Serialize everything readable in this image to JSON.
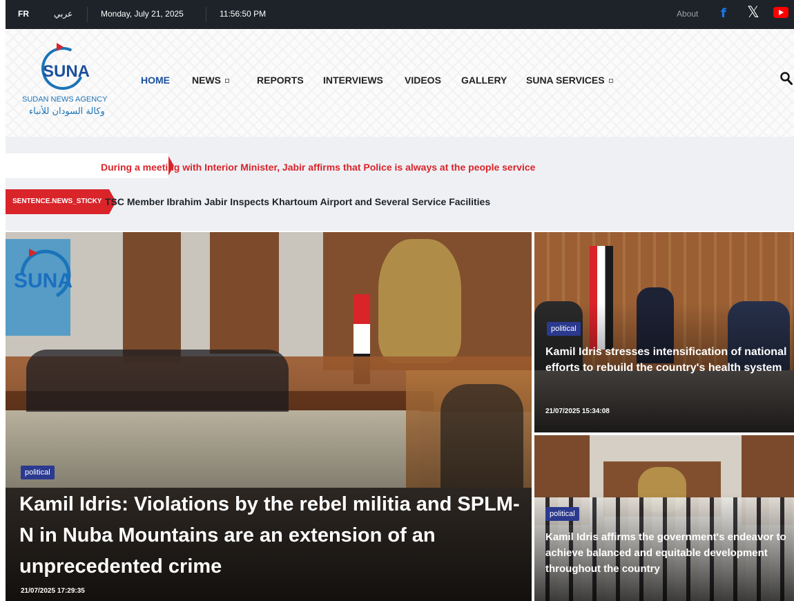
{
  "topbar": {
    "lang_fr": "FR",
    "lang_ar": "عربي",
    "date": "Monday, July 21, 2025",
    "time": "11:56:50 PM",
    "about": "About",
    "social": [
      "facebook-icon",
      "x-icon",
      "youtube-icon"
    ],
    "colors": {
      "background": "#1e2329",
      "facebook": "#1877f2",
      "youtube": "#ff0000"
    }
  },
  "logo": {
    "word": "SUNA",
    "english": "SUDAN NEWS AGENCY",
    "arabic": "وكالة السودان للأنباء",
    "colors": {
      "blue": "#1b4f9c",
      "red": "#d9242a"
    }
  },
  "nav": {
    "items": [
      {
        "label": "HOME",
        "active": true
      },
      {
        "label": "NEWS",
        "has_dropdown": true
      },
      {
        "label": "REPORTS"
      },
      {
        "label": "INTERVIEWS"
      },
      {
        "label": "VIDEOS"
      },
      {
        "label": "GALLERY"
      },
      {
        "label": "SUNA SERVICES",
        "has_dropdown": true
      }
    ],
    "search_icon": "search-icon"
  },
  "ticker": {
    "headline_1": "During a meeting with Interior Minister, Jabir affirms that Police is always at the people service",
    "label": "SENTENCE.NEWS_STICKY",
    "headline_2": "TSC Member Ibrahim Jabir Inspects Khartoum Airport and Several Service Facilities",
    "accent": "#d9242a"
  },
  "featured": {
    "main": {
      "category": "political",
      "title": "Kamil Idris: Violations by the rebel militia and SPLM-N in Nuba Mountains are an extension of an unprecedented crime",
      "date": "21/07/2025 17:29:35"
    },
    "side": [
      {
        "category": "political",
        "title": "Kamil Idris stresses intensification of national efforts to rebuild the country's health system",
        "date": "21/07/2025 15:34:08"
      },
      {
        "category": "political",
        "title": "Kamil Idris affirms the government's endeavor to achieve balanced and equitable development throughout the country"
      }
    ],
    "badge_color": "#2b3a8f"
  }
}
